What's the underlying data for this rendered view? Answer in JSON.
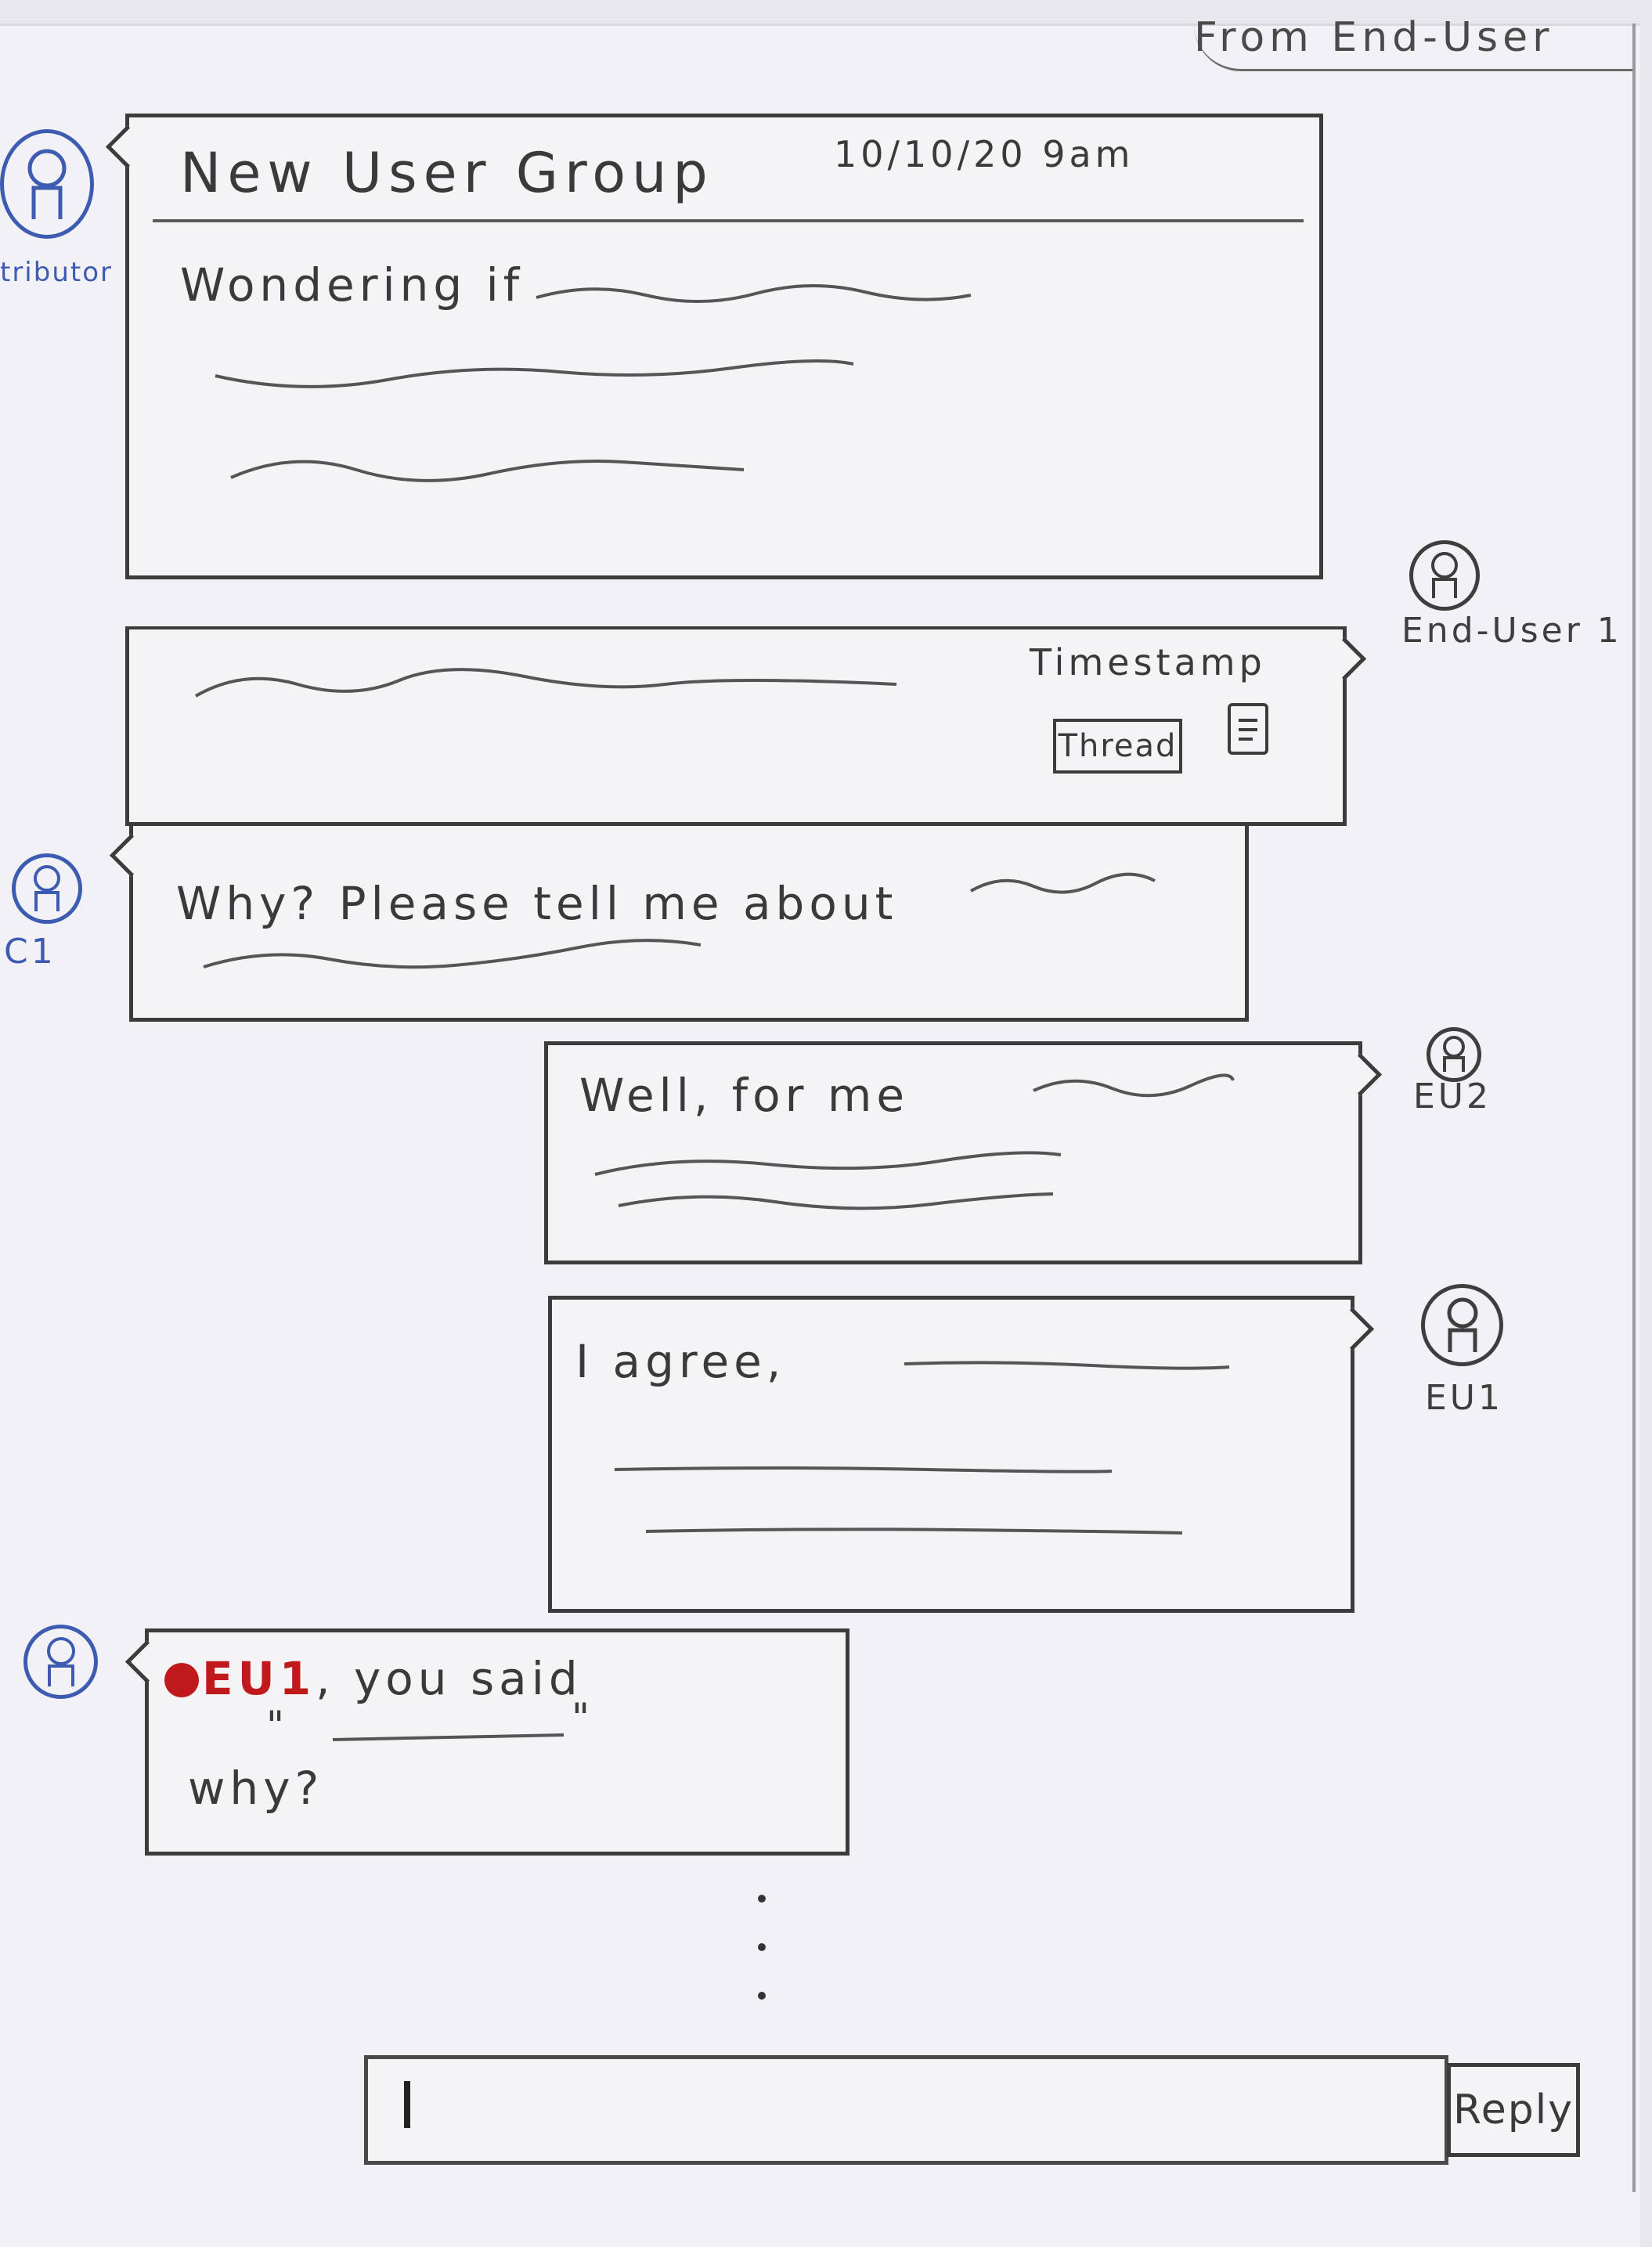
{
  "header": {
    "caption": "From End-User"
  },
  "colors": {
    "contributor_blue": "#3d5bb0",
    "mention_red": "#c0191c",
    "pencil": "#3a3a3a"
  },
  "icons": {
    "avatar": "user-avatar-icon",
    "document": "document-icon"
  },
  "messages": [
    {
      "id": "post",
      "user_label": "tributor",
      "title": "New User Group",
      "timestamp": "10/10/20 9am",
      "text": "Wondering if"
    },
    {
      "id": "reply-eu1",
      "user_label": "End-User 1",
      "timestamp": "Timestamp",
      "thread_label": "Thread"
    },
    {
      "id": "reply-c1",
      "user_label": "C1",
      "text": "Why? Please tell me about"
    },
    {
      "id": "reply-eu2",
      "user_label": "EU2",
      "text": "Well, for me"
    },
    {
      "id": "reply-eu1b",
      "user_label": "EU1",
      "text": "I agree,"
    },
    {
      "id": "reply-contrib",
      "mention": "EU1",
      "text_after": ", you said",
      "quote_open": "\"",
      "quote_close": "\"",
      "text2": "why?"
    }
  ],
  "composer": {
    "reply_label": "Reply"
  }
}
